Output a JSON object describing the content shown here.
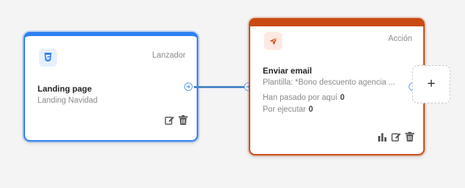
{
  "trigger_node": {
    "kind": "Lanzador",
    "title": "Landing page",
    "subtitle": "Landing Navidad",
    "icon": "css3-icon",
    "accent": "#2f80f0"
  },
  "action_node": {
    "kind": "Acción",
    "title": "Enviar email",
    "subtitle": "Plantilla: *Bono descuento agencia ...",
    "icon": "paper-plane-icon",
    "accent": "#c94a12",
    "stats": [
      {
        "label": "Han pasado por aquí",
        "value": "0"
      },
      {
        "label": "Por ejecutar",
        "value": "0"
      }
    ]
  },
  "add_node": {
    "label": "+"
  }
}
